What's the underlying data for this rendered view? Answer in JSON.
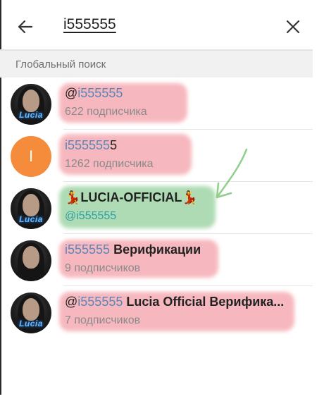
{
  "header": {
    "query": "i555555"
  },
  "section": {
    "title": "Глобальный поиск"
  },
  "results": [
    {
      "avatar_type": "photo",
      "avatar_text": "Lucia",
      "title_prefix": "@",
      "title_match": "i555555",
      "title_rest": "",
      "subtitle": "622 подписчика",
      "highlight": "red"
    },
    {
      "avatar_type": "letter",
      "avatar_text": "I",
      "title_prefix": "",
      "title_match": "i555555",
      "title_rest": "5",
      "subtitle": "1262 подписчика",
      "highlight": "red"
    },
    {
      "avatar_type": "photo",
      "avatar_text": "Lucia",
      "title_emoji": "💃",
      "title_text": "LUCIA-OFFICIAL",
      "subtitle": "@i555555",
      "highlight": "green"
    },
    {
      "avatar_type": "photo",
      "avatar_text": "",
      "title_prefix": "",
      "title_match": "i555555",
      "title_rest": " Верификации",
      "subtitle": "9 подписчиков",
      "highlight": "red"
    },
    {
      "avatar_type": "photo",
      "avatar_text": "Lucia",
      "title_prefix": "@",
      "title_match": "i555555",
      "title_rest": " Lucia Official Верифика...",
      "subtitle": "7 подписчиков",
      "highlight": "red"
    }
  ],
  "colors": {
    "match": "#5b86b8",
    "highlight_red": "#f18c96",
    "highlight_green": "#78c382",
    "avatar_letter": "#f48c3b"
  },
  "icons": {
    "back": "arrow-left-icon",
    "clear": "close-icon",
    "annotation": "hand-drawn-arrow-icon"
  }
}
